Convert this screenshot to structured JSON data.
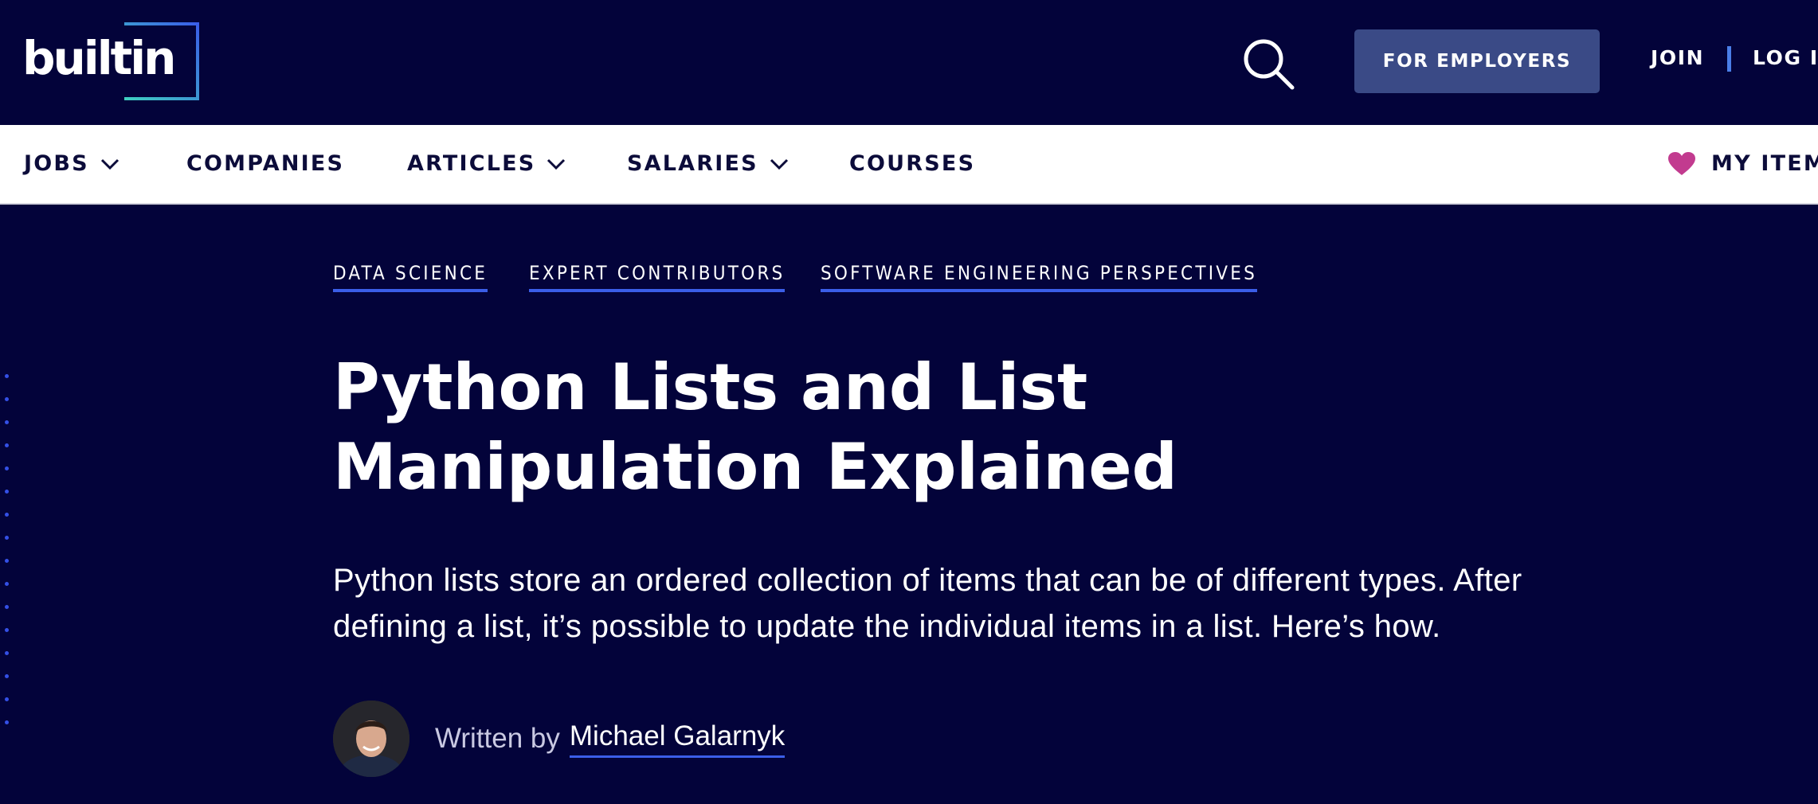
{
  "header": {
    "logo_text": "builtin",
    "search_icon": "search-icon",
    "for_employers_label": "FOR EMPLOYERS",
    "join_label": "JOIN",
    "login_label": "LOG I"
  },
  "nav": {
    "items": [
      {
        "label": "JOBS",
        "has_dropdown": true
      },
      {
        "label": "COMPANIES",
        "has_dropdown": false
      },
      {
        "label": "ARTICLES",
        "has_dropdown": true
      },
      {
        "label": "SALARIES",
        "has_dropdown": true
      },
      {
        "label": "COURSES",
        "has_dropdown": false
      }
    ],
    "my_items_label": "MY ITEM",
    "my_items_icon": "heart-icon"
  },
  "article": {
    "tags": [
      "DATA SCIENCE",
      "EXPERT CONTRIBUTORS",
      "SOFTWARE ENGINEERING PERSPECTIVES"
    ],
    "title": "Python Lists and List Manipulation Explained",
    "summary": "Python lists store an ordered collection of items that can be of different types. After defining a list, it’s possible to update the individual items in a list. Here’s how.",
    "written_by_label": "Written by",
    "author_name": "Michael Galarnyk"
  },
  "colors": {
    "background": "#03033a",
    "nav_background": "#ffffff",
    "button_background": "#3a4a86",
    "accent_blue": "#3b5ee8",
    "heart": "#c23b8f"
  }
}
